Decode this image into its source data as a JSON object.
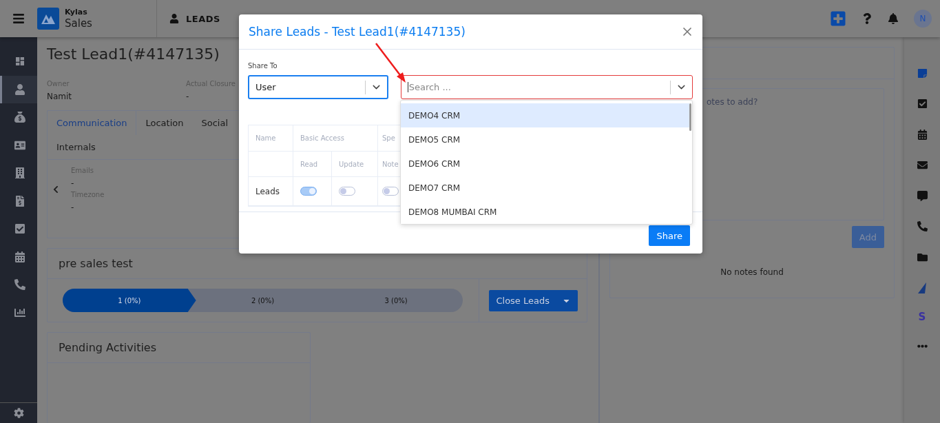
{
  "app": {
    "name": "Kylas",
    "product": "Sales"
  },
  "module": "LEADS",
  "avatar": "N",
  "sidebar": {
    "items": [
      {
        "kind": "dashboard",
        "selected": false
      },
      {
        "kind": "leads",
        "selected": true
      },
      {
        "kind": "deals",
        "selected": false
      },
      {
        "kind": "contacts",
        "selected": false
      },
      {
        "kind": "companies",
        "selected": false
      },
      {
        "kind": "quotes",
        "selected": false
      },
      {
        "kind": "tasks",
        "selected": false
      },
      {
        "kind": "calendar",
        "selected": false
      },
      {
        "kind": "calls",
        "selected": false
      },
      {
        "kind": "reports",
        "selected": false
      }
    ]
  },
  "lead": {
    "title": "Test Lead1(#4147135)",
    "fields": [
      {
        "label": "Owner",
        "value": "Namit"
      },
      {
        "label": "Actual Closure",
        "value": "-"
      }
    ]
  },
  "tabs": [
    {
      "label": "Communication",
      "selected": true
    },
    {
      "label": "Location",
      "selected": false
    },
    {
      "label": "Social",
      "selected": false
    },
    {
      "label": "Internals",
      "selected": false
    }
  ],
  "details": [
    {
      "label": "Emails",
      "value": "-"
    },
    {
      "label": "Timezone",
      "value": "-"
    }
  ],
  "pipeline": {
    "title": "pre sales test",
    "stages": [
      {
        "label": "1 (0%)",
        "selected": true
      },
      {
        "label": "2 (0%)",
        "selected": false
      },
      {
        "label": "3 (0%)",
        "selected": false
      }
    ],
    "action": "Close Leads"
  },
  "pending": {
    "title": "Pending Activities"
  },
  "notes": {
    "placeholder": "otes to add?",
    "add": "Add",
    "empty": "No notes found"
  },
  "right_rail": {
    "letter": "S"
  },
  "modal": {
    "title": "Share Leads - Test Lead1(#4147135)",
    "share_to_label": "Share To",
    "share_to": "User",
    "search_placeholder": "Search ...",
    "table": {
      "columns": [
        "Name",
        "Basic Access",
        "Spe"
      ],
      "subcolumns": [
        "Read",
        "Update",
        "Note"
      ],
      "rows": [
        {
          "name": "Leads",
          "toggles": [
            {
              "on": true
            },
            {
              "on": false
            },
            {
              "on": false
            }
          ]
        }
      ]
    },
    "options": [
      {
        "label": "DEMO4 CRM",
        "selected": true
      },
      {
        "label": "DEMO5 CRM",
        "selected": false
      },
      {
        "label": "DEMO6 CRM",
        "selected": false
      },
      {
        "label": "DEMO7 CRM",
        "selected": false
      },
      {
        "label": "DEMO8 MUMBAI CRM",
        "selected": false
      }
    ],
    "submit": "Share"
  }
}
